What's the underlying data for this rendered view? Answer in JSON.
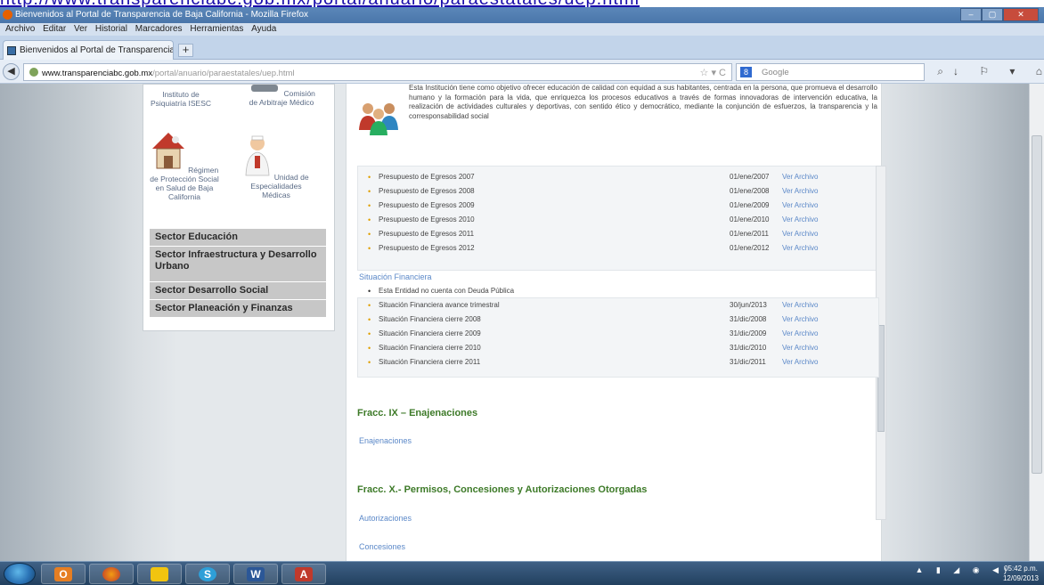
{
  "url_strip": "http://www.transparenciabc.gob.mx/portal/anuario/paraestatales/uep.html",
  "window": {
    "title": "Bienvenidos al Portal de Transparencia de Baja California - Mozilla Firefox",
    "controls": [
      "–",
      "▢",
      "✕"
    ]
  },
  "menu": [
    "Archivo",
    "Editar",
    "Ver",
    "Historial",
    "Marcadores",
    "Herramientas",
    "Ayuda"
  ],
  "tab": {
    "label": "Bienvenidos al Portal de Transparencia d...",
    "new_tab": "+"
  },
  "nav": {
    "back": "◀",
    "url_domain": "www.transparenciabc.gob.mx",
    "url_path": "/portal/anuario/paraestatales/uep.html",
    "star": "☆ ▾ C",
    "search_engine": "8",
    "search_placeholder": "Google",
    "icons": "↓ ⚐ ▾ ⌂"
  },
  "sidebar": {
    "institutions": [
      {
        "name": "Instituto de Psiquiatría ISESC"
      },
      {
        "name": "Comisión de Arbitraje Médico"
      },
      {
        "name": "Régimen de Protección Social en Salud de Baja California"
      },
      {
        "name": "Unidad de Especialidades Médicas"
      }
    ],
    "sectors": [
      "Sector Educación",
      "Sector Infraestructura y Desarrollo Urbano",
      "Sector Desarrollo Social",
      "Sector Planeación y Finanzas"
    ]
  },
  "main": {
    "intro": "Esta Institución tiene como objetivo ofrecer educación de calidad con equidad a sus habitantes, centrada en la persona, que promueva el desarrollo humano y la formación para la vida, que enriquezca los procesos educativos a través de formas innovadoras de intervención educativa, la realización de actividades culturales y deportivas, con sentido ético y democrático, mediante la conjunción de esfuerzos, la transparencia y la corresponsabilidad social",
    "budget_rows": [
      {
        "label": "Presupuesto de Egresos 2007",
        "date": "01/ene/2007",
        "link": "Ver Archivo"
      },
      {
        "label": "Presupuesto de Egresos 2008",
        "date": "01/ene/2008",
        "link": "Ver Archivo"
      },
      {
        "label": "Presupuesto de Egresos 2009",
        "date": "01/ene/2009",
        "link": "Ver Archivo"
      },
      {
        "label": "Presupuesto de Egresos 2010",
        "date": "01/ene/2010",
        "link": "Ver Archivo"
      },
      {
        "label": "Presupuesto de Egresos 2011",
        "date": "01/ene/2011",
        "link": "Ver Archivo"
      },
      {
        "label": "Presupuesto de Egresos 2012",
        "date": "01/ene/2012",
        "link": "Ver Archivo"
      }
    ],
    "situacion_title": "Situación Financiera",
    "situacion_note": "Esta Entidad no cuenta con Deuda Pública",
    "situacion_rows": [
      {
        "label": "Situación Financiera avance trimestral",
        "date": "30/jun/2013",
        "link": "Ver Archivo"
      },
      {
        "label": "Situación Financiera cierre 2008",
        "date": "31/dic/2008",
        "link": "Ver Archivo"
      },
      {
        "label": "Situación Financiera cierre 2009",
        "date": "31/dic/2009",
        "link": "Ver Archivo"
      },
      {
        "label": "Situación Financiera cierre 2010",
        "date": "31/dic/2010",
        "link": "Ver Archivo"
      },
      {
        "label": "Situación Financiera cierre 2011",
        "date": "31/dic/2011",
        "link": "Ver Archivo"
      }
    ],
    "fracc_ix": "Fracc. IX – Enajenaciones",
    "enajenaciones": "Enajenaciones",
    "fracc_x": "Fracc. X.- Permisos, Concesiones y Autorizaciones Otorgadas",
    "autorizaciones": "Autorizaciones",
    "concesiones": "Concesiones"
  },
  "taskbar": {
    "apps": [
      "O",
      "",
      "",
      "S",
      "W",
      "A"
    ],
    "tray": "▲ ▮ ◢ ◉ ◀)",
    "time": "05:42 p.m.",
    "date": "12/09/2013"
  }
}
